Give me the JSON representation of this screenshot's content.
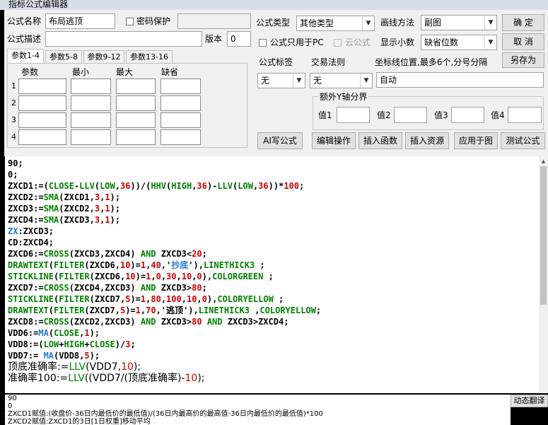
{
  "window": {
    "title": "指标公式编辑器"
  },
  "form": {
    "name_label": "公式名称",
    "name_value": "布局逃顶",
    "password_label": "密码保护",
    "password_value": "",
    "desc_label": "公式描述",
    "desc_value": "",
    "version_label": "版本",
    "version_value": "0",
    "type_label": "公式类型",
    "type_value": "其他类型",
    "draw_label": "画线方法",
    "draw_value": "副图",
    "pc_only_label": "公式只用于PC",
    "cloud_label": "云公式",
    "decimals_label": "显示小数",
    "decimals_value": "缺省位数",
    "tag_label": "公式标签",
    "tag_value": "无",
    "trade_label": "交易法则",
    "trade_value": "无",
    "axis_label": "坐标线位置,最多6个,分号分隔",
    "axis_value": "自动"
  },
  "buttons": {
    "ok": "确  定",
    "cancel": "取  消",
    "save_as": "另存为",
    "ai_write": "AI写公式",
    "edit_ops": "编辑操作",
    "insert_func": "插入函数",
    "insert_res": "插入资源",
    "apply_chart": "应用于图",
    "test_formula": "测试公式"
  },
  "tabs": [
    "参数1-4",
    "参数5-8",
    "参数9-12",
    "参数13-16"
  ],
  "params": {
    "headers": [
      "参数",
      "最小",
      "最大",
      "缺省"
    ],
    "rows": [
      "1",
      "2",
      "3",
      "4"
    ]
  },
  "extra_axis": {
    "title": "额外Y轴分界",
    "labels": [
      "值1",
      "值2",
      "值3",
      "值4"
    ]
  },
  "code_lines": [
    [
      {
        "t": "90;",
        "c": "#000000"
      }
    ],
    [
      {
        "t": "0;",
        "c": "#000000"
      }
    ],
    [
      {
        "t": "ZXCD1:=(",
        "c": "#000000"
      },
      {
        "t": "CLOSE",
        "c": "#008000"
      },
      {
        "t": "-",
        "c": "#000000"
      },
      {
        "t": "LLV",
        "c": "#008000"
      },
      {
        "t": "(",
        "c": "#000000"
      },
      {
        "t": "LOW",
        "c": "#008000"
      },
      {
        "t": ",",
        "c": "#000000"
      },
      {
        "t": "36",
        "c": "#cc0000"
      },
      {
        "t": "))/(",
        "c": "#000000"
      },
      {
        "t": "HHV",
        "c": "#008000"
      },
      {
        "t": "(",
        "c": "#000000"
      },
      {
        "t": "HIGH",
        "c": "#008000"
      },
      {
        "t": ",",
        "c": "#000000"
      },
      {
        "t": "36",
        "c": "#cc0000"
      },
      {
        "t": ")-",
        "c": "#000000"
      },
      {
        "t": "LLV",
        "c": "#008000"
      },
      {
        "t": "(",
        "c": "#000000"
      },
      {
        "t": "LOW",
        "c": "#008000"
      },
      {
        "t": ",",
        "c": "#000000"
      },
      {
        "t": "36",
        "c": "#cc0000"
      },
      {
        "t": "))*",
        "c": "#000000"
      },
      {
        "t": "100",
        "c": "#cc0000"
      },
      {
        "t": ";",
        "c": "#000000"
      }
    ],
    [
      {
        "t": "ZXCD2:=",
        "c": "#000000"
      },
      {
        "t": "SMA",
        "c": "#008000"
      },
      {
        "t": "(ZXCD1,",
        "c": "#000000"
      },
      {
        "t": "3",
        "c": "#cc0000"
      },
      {
        "t": ",",
        "c": "#000000"
      },
      {
        "t": "1",
        "c": "#cc0000"
      },
      {
        "t": ");",
        "c": "#000000"
      }
    ],
    [
      {
        "t": "ZXCD3:=",
        "c": "#000000"
      },
      {
        "t": "SMA",
        "c": "#008000"
      },
      {
        "t": "(ZXCD2,",
        "c": "#000000"
      },
      {
        "t": "3",
        "c": "#cc0000"
      },
      {
        "t": ",",
        "c": "#000000"
      },
      {
        "t": "1",
        "c": "#cc0000"
      },
      {
        "t": ");",
        "c": "#000000"
      }
    ],
    [
      {
        "t": "ZXCD4:=",
        "c": "#000000"
      },
      {
        "t": "SMA",
        "c": "#008000"
      },
      {
        "t": "(ZXCD3,",
        "c": "#000000"
      },
      {
        "t": "3",
        "c": "#cc0000"
      },
      {
        "t": ",",
        "c": "#000000"
      },
      {
        "t": "1",
        "c": "#cc0000"
      },
      {
        "t": ");",
        "c": "#000000"
      }
    ],
    [
      {
        "t": "ZX",
        "c": "#1e7ad6"
      },
      {
        "t": ":ZXCD3;",
        "c": "#000000"
      }
    ],
    [
      {
        "t": "CD:ZXCD4;",
        "c": "#000000"
      }
    ],
    [
      {
        "t": "ZXCD6:=",
        "c": "#000000"
      },
      {
        "t": "CROSS",
        "c": "#008000"
      },
      {
        "t": "(ZXCD3,ZXCD4) ",
        "c": "#000000"
      },
      {
        "t": "AND",
        "c": "#008000"
      },
      {
        "t": " ZXCD3<",
        "c": "#000000"
      },
      {
        "t": "20",
        "c": "#cc0000"
      },
      {
        "t": ";",
        "c": "#000000"
      }
    ],
    [
      {
        "t": "DRAWTEXT",
        "c": "#008000"
      },
      {
        "t": "(",
        "c": "#000000"
      },
      {
        "t": "FILTER",
        "c": "#008000"
      },
      {
        "t": "(ZXCD6,",
        "c": "#000000"
      },
      {
        "t": "10",
        "c": "#cc0000"
      },
      {
        "t": ")=",
        "c": "#000000"
      },
      {
        "t": "1",
        "c": "#cc0000"
      },
      {
        "t": ",",
        "c": "#000000"
      },
      {
        "t": "40",
        "c": "#cc0000"
      },
      {
        "t": ",'",
        "c": "#000000"
      },
      {
        "t": "抄底",
        "c": "#1e7ad6"
      },
      {
        "t": "'),",
        "c": "#000000"
      },
      {
        "t": "LINETHICK3",
        "c": "#008000"
      },
      {
        "t": " ;",
        "c": "#000000"
      }
    ],
    [
      {
        "t": "STICKLINE",
        "c": "#008000"
      },
      {
        "t": "(",
        "c": "#000000"
      },
      {
        "t": "FILTER",
        "c": "#008000"
      },
      {
        "t": "(ZXCD6,",
        "c": "#000000"
      },
      {
        "t": "10",
        "c": "#cc0000"
      },
      {
        "t": ")=",
        "c": "#000000"
      },
      {
        "t": "1",
        "c": "#cc0000"
      },
      {
        "t": ",",
        "c": "#000000"
      },
      {
        "t": "0",
        "c": "#cc0000"
      },
      {
        "t": ",",
        "c": "#000000"
      },
      {
        "t": "30",
        "c": "#cc0000"
      },
      {
        "t": ",",
        "c": "#000000"
      },
      {
        "t": "10",
        "c": "#cc0000"
      },
      {
        "t": ",",
        "c": "#000000"
      },
      {
        "t": "0",
        "c": "#cc0000"
      },
      {
        "t": "),",
        "c": "#000000"
      },
      {
        "t": "COLORGREEN",
        "c": "#008000"
      },
      {
        "t": " ;",
        "c": "#000000"
      }
    ],
    [
      {
        "t": "ZXCD7:=",
        "c": "#000000"
      },
      {
        "t": "CROSS",
        "c": "#008000"
      },
      {
        "t": "(ZXCD4,ZXCD3) ",
        "c": "#000000"
      },
      {
        "t": "AND",
        "c": "#008000"
      },
      {
        "t": " ZXCD3>",
        "c": "#000000"
      },
      {
        "t": "80",
        "c": "#cc0000"
      },
      {
        "t": ";",
        "c": "#000000"
      }
    ],
    [
      {
        "t": "STICKLINE",
        "c": "#008000"
      },
      {
        "t": "(",
        "c": "#000000"
      },
      {
        "t": "FILTER",
        "c": "#008000"
      },
      {
        "t": "(ZXCD7,",
        "c": "#000000"
      },
      {
        "t": "5",
        "c": "#cc0000"
      },
      {
        "t": ")=",
        "c": "#000000"
      },
      {
        "t": "1",
        "c": "#cc0000"
      },
      {
        "t": ",",
        "c": "#000000"
      },
      {
        "t": "80",
        "c": "#cc0000"
      },
      {
        "t": ",",
        "c": "#000000"
      },
      {
        "t": "100",
        "c": "#cc0000"
      },
      {
        "t": ",",
        "c": "#000000"
      },
      {
        "t": "10",
        "c": "#cc0000"
      },
      {
        "t": ",",
        "c": "#000000"
      },
      {
        "t": "0",
        "c": "#cc0000"
      },
      {
        "t": "),",
        "c": "#000000"
      },
      {
        "t": "COLORYELLOW",
        "c": "#008000"
      },
      {
        "t": " ;",
        "c": "#000000"
      }
    ],
    [
      {
        "t": "DRAWTEXT",
        "c": "#008000"
      },
      {
        "t": "(",
        "c": "#000000"
      },
      {
        "t": "FILTER",
        "c": "#008000"
      },
      {
        "t": "(ZXCD7,",
        "c": "#000000"
      },
      {
        "t": "5",
        "c": "#cc0000"
      },
      {
        "t": ")=",
        "c": "#000000"
      },
      {
        "t": "1",
        "c": "#cc0000"
      },
      {
        "t": ",",
        "c": "#000000"
      },
      {
        "t": "70",
        "c": "#cc0000"
      },
      {
        "t": ",'逃顶'),",
        "c": "#000000"
      },
      {
        "t": "LINETHICK3",
        "c": "#008000"
      },
      {
        "t": " ,",
        "c": "#000000"
      },
      {
        "t": "COLORYELLOW",
        "c": "#008000"
      },
      {
        "t": ";",
        "c": "#000000"
      }
    ],
    [
      {
        "t": "ZXCD8:=",
        "c": "#000000"
      },
      {
        "t": "CROSS",
        "c": "#008000"
      },
      {
        "t": "(ZXCD2,ZXCD3) ",
        "c": "#000000"
      },
      {
        "t": "AND",
        "c": "#008000"
      },
      {
        "t": " ZXCD3>",
        "c": "#000000"
      },
      {
        "t": "80",
        "c": "#cc0000"
      },
      {
        "t": " ",
        "c": "#000000"
      },
      {
        "t": "AND",
        "c": "#008000"
      },
      {
        "t": " ZXCD3>ZXCD4;",
        "c": "#000000"
      }
    ],
    [
      {
        "t": "VDD6:=",
        "c": "#000000"
      },
      {
        "t": "MA",
        "c": "#1e7ad6"
      },
      {
        "t": "(",
        "c": "#000000"
      },
      {
        "t": "CLOSE",
        "c": "#008000"
      },
      {
        "t": ",",
        "c": "#000000"
      },
      {
        "t": "1",
        "c": "#cc0000"
      },
      {
        "t": ");",
        "c": "#000000"
      }
    ],
    [
      {
        "t": "VDD8:=(",
        "c": "#000000"
      },
      {
        "t": "LOW",
        "c": "#008000"
      },
      {
        "t": "+",
        "c": "#000000"
      },
      {
        "t": "HIGH",
        "c": "#008000"
      },
      {
        "t": "+",
        "c": "#000000"
      },
      {
        "t": "CLOSE",
        "c": "#008000"
      },
      {
        "t": ")/",
        "c": "#000000"
      },
      {
        "t": "3",
        "c": "#cc0000"
      },
      {
        "t": ";",
        "c": "#000000"
      }
    ],
    [
      {
        "t": "VDD7:= ",
        "c": "#000000"
      },
      {
        "t": "MA",
        "c": "#1e7ad6"
      },
      {
        "t": "(VDD8,",
        "c": "#000000"
      },
      {
        "t": "5",
        "c": "#cc0000"
      },
      {
        "t": ");",
        "c": "#000000"
      }
    ],
    [
      {
        "t": "顶底准确率:=",
        "c": "#000000"
      },
      {
        "t": "LLV",
        "c": "#008000"
      },
      {
        "t": "(VDD7,",
        "c": "#000000"
      },
      {
        "t": "10",
        "c": "#cc0000"
      },
      {
        "t": ");",
        "c": "#000000"
      }
    ],
    [
      {
        "t": "准确率100:=",
        "c": "#000000"
      },
      {
        "t": "LLV",
        "c": "#008000"
      },
      {
        "t": "((VDD7/(顶底准确率)-",
        "c": "#000000"
      },
      {
        "t": "10",
        "c": "#cc0000"
      },
      {
        "t": ");",
        "c": "#000000"
      }
    ]
  ],
  "output_lines": [
    "90",
    "0",
    "ZXCD1赋值:(收盘价-36日内最低价的最低值)/(36日内最高价的最高值-36日内最低价的最低值)*100",
    "ZXCD2赋值:ZXCD1的3日[1日权重]移动平均"
  ],
  "output_button": "动态翻译"
}
